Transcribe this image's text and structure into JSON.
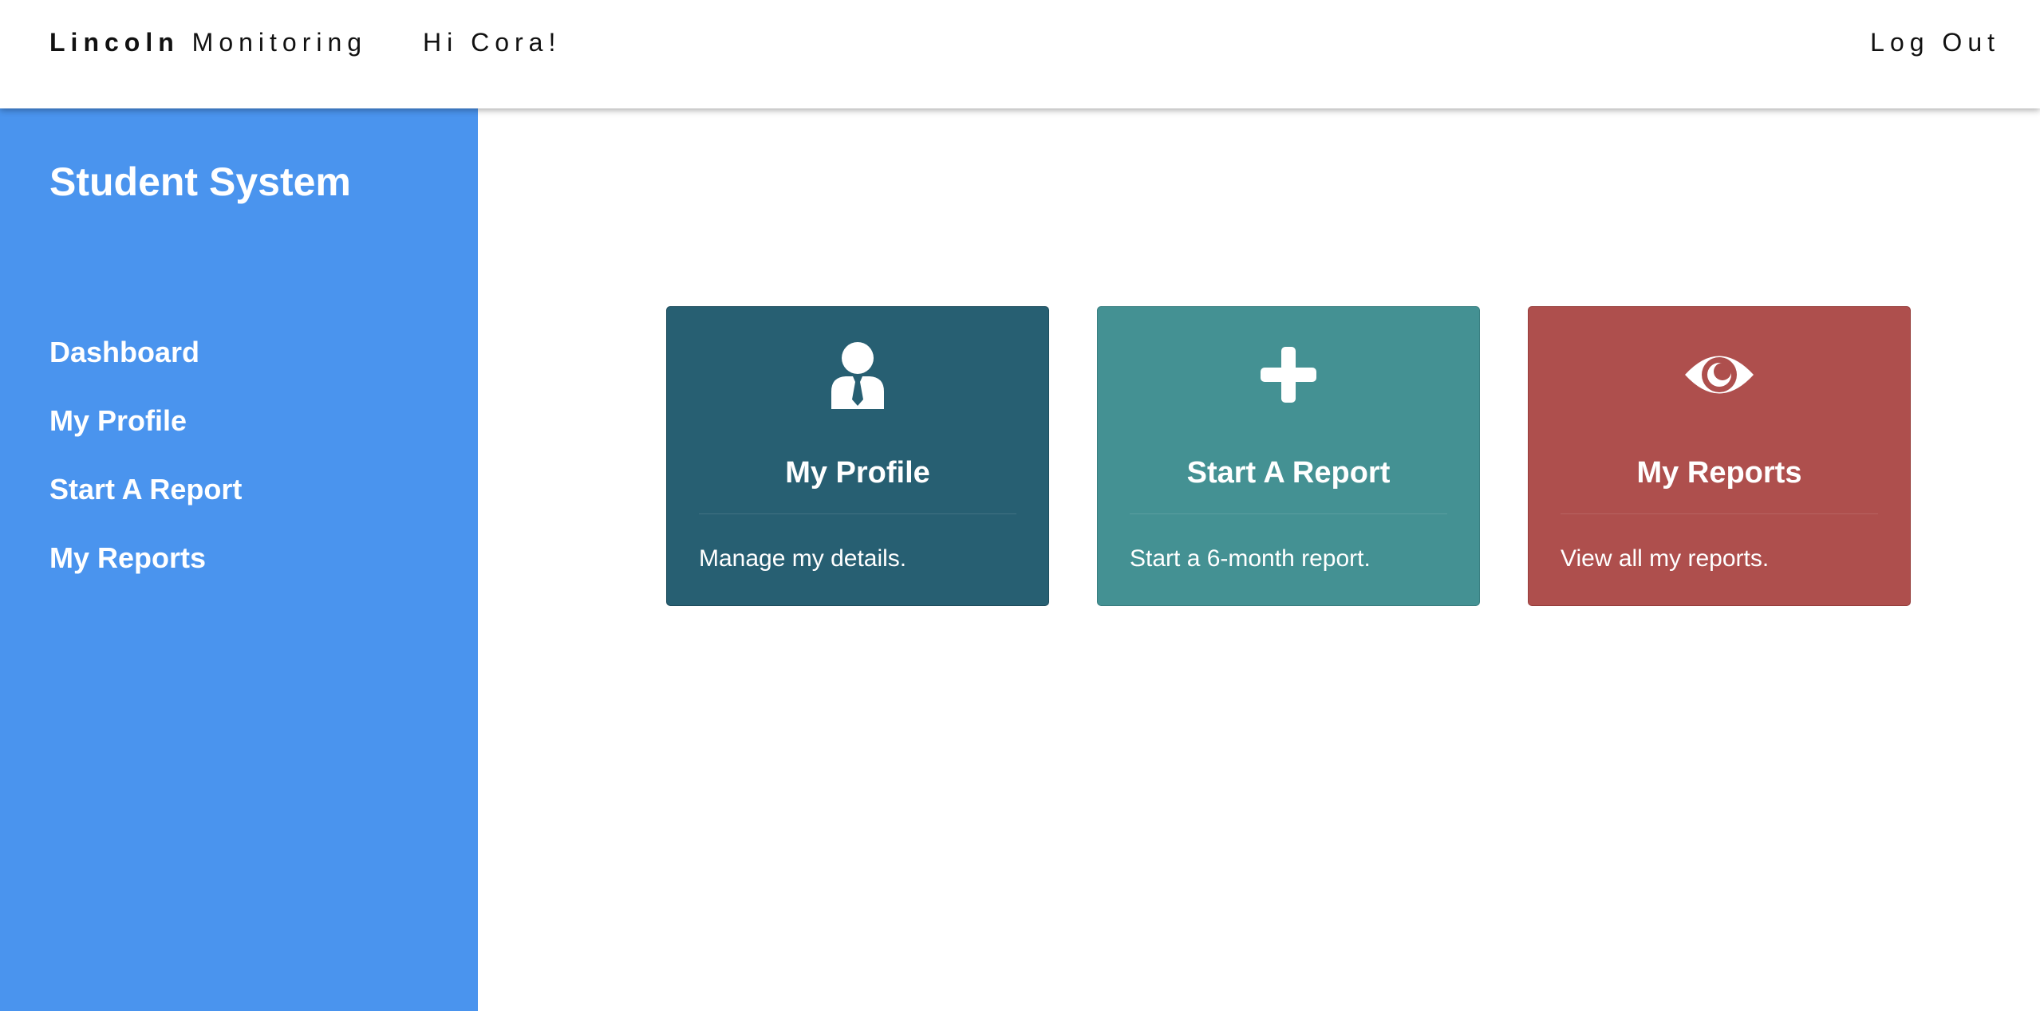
{
  "header": {
    "brand_bold": "Lincoln",
    "brand_rest": "Monitoring",
    "greeting": "Hi Cora!",
    "logout_label": "Log Out"
  },
  "sidebar": {
    "title": "Student System",
    "items": [
      {
        "label": "Dashboard"
      },
      {
        "label": "My Profile"
      },
      {
        "label": "Start A Report"
      },
      {
        "label": "My Reports"
      }
    ],
    "color": "#4a94ee"
  },
  "cards": [
    {
      "title": "My Profile",
      "description": "Manage my details.",
      "icon": "user-tie-icon",
      "color": "#275f72"
    },
    {
      "title": "Start A Report",
      "description": "Start a 6-month report.",
      "icon": "plus-icon",
      "color": "#449193"
    },
    {
      "title": "My Reports",
      "description": "View all my reports.",
      "icon": "eye-icon",
      "color": "#ae4f4d"
    }
  ]
}
